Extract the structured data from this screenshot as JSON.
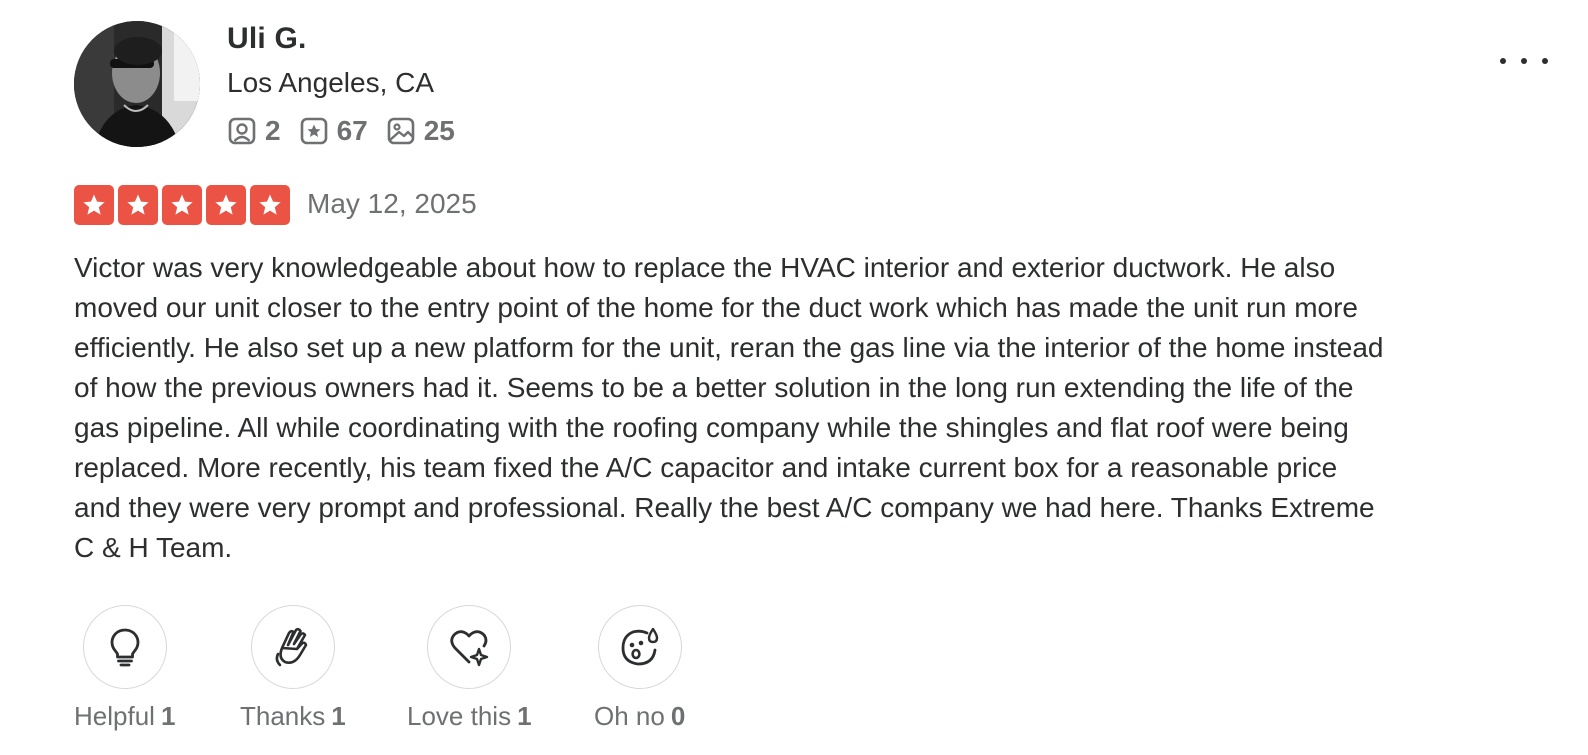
{
  "user": {
    "name": "Uli G.",
    "location": "Los Angeles, CA",
    "stats": [
      {
        "icon": "friends-icon",
        "value": "2"
      },
      {
        "icon": "review-star-icon",
        "value": "67"
      },
      {
        "icon": "photo-icon",
        "value": "25"
      }
    ]
  },
  "review": {
    "rating": 5,
    "rating_max": 5,
    "date": "May 12, 2025",
    "text": "Victor was very knowledgeable about how to replace the HVAC interior and exterior ductwork. He also moved our unit closer to the entry point of the home for the duct work which has made the unit run more efficiently. He also set up a new platform for the unit, reran the gas line via the interior of the home instead of how the previous owners had it. Seems to be a better solution in the long run extending the life of the gas pipeline. All while coordinating with the roofing company while the shingles and flat roof were being replaced. More recently, his team fixed the A/C capacitor and intake current box for a reasonable price and they were very prompt and professional. Really the best A/C company we had here. Thanks Extreme C & H Team."
  },
  "reactions": [
    {
      "icon": "lightbulb-icon",
      "label": "Helpful",
      "count": "1"
    },
    {
      "icon": "clapping-hands-icon",
      "label": "Thanks",
      "count": "1"
    },
    {
      "icon": "heart-sparkle-icon",
      "label": "Love this",
      "count": "1"
    },
    {
      "icon": "surprised-face-icon",
      "label": "Oh no",
      "count": "0"
    }
  ],
  "colors": {
    "star_red": "#eb5445",
    "text_primary": "#2d2e2f",
    "text_secondary": "#6e7072"
  }
}
